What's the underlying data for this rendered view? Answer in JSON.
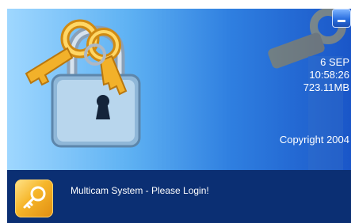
{
  "window": {
    "minimize_label": "minimize"
  },
  "status": {
    "date": "6 SEP",
    "time": "10:58:26",
    "memory": "723.11MB"
  },
  "copyright": "Copyright 2004",
  "footer": {
    "message": "Multicam System - Please Login!"
  },
  "icons": {
    "lock": "padlock-with-keys-icon",
    "login": "key-icon"
  },
  "colors": {
    "footer_bg": "#0b2f73",
    "hero_gradient_start": "#9fd7ff",
    "hero_gradient_end": "#1a56c8",
    "key_gold": "#f6b62a"
  }
}
